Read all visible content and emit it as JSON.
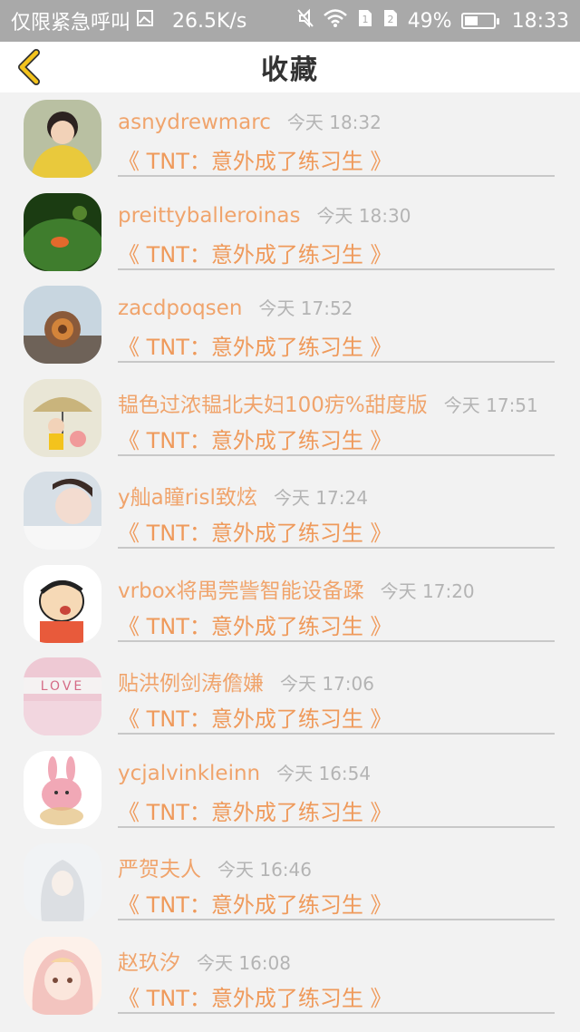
{
  "status_bar": {
    "carrier": "仅限紧急呼叫",
    "speed": "26.5K/s",
    "battery_percent": "49%",
    "battery_level": 0.49,
    "time": "18:33"
  },
  "header": {
    "title": "收藏",
    "back_icon": "chevron-left-icon",
    "accent": "#f3c31c"
  },
  "items": [
    {
      "user": "asnydrewmarc",
      "time": "今天 18:32",
      "book": "《 TNT：意外成了练习生 》",
      "avatar_color": "#e9c93c"
    },
    {
      "user": "preittyballeroinas",
      "time": "今天 18:30",
      "book": "《 TNT：意外成了练习生 》",
      "avatar_color": "#3f7d2d"
    },
    {
      "user": "zacdpoqsen",
      "time": "今天 17:52",
      "book": "《 TNT：意外成了练习生 》",
      "avatar_color": "#8a5a3a"
    },
    {
      "user": "韫色过浓韫北夫妇100疠%甜度版",
      "time": "今天 17:51",
      "book": "《 TNT：意外成了练习生 》",
      "avatar_color": "#c9b47c"
    },
    {
      "user": "y舢a瞳risl致炫",
      "time": "今天 17:24",
      "book": "《 TNT：意外成了练习生 》",
      "avatar_color": "#d7dfe6"
    },
    {
      "user": "vrbox将禺莞訾智能设备蹂",
      "time": "今天 17:20",
      "book": "《 TNT：意外成了练习生 》",
      "avatar_color": "#e85a3b"
    },
    {
      "user": "贴洪例剑涛儋嫌",
      "time": "今天 17:06",
      "book": "《 TNT：意外成了练习生 》",
      "avatar_color": "#eec9d4"
    },
    {
      "user": "ycjalvinkleinn",
      "time": "今天 16:54",
      "book": "《 TNT：意外成了练习生 》",
      "avatar_color": "#f1a8b6"
    },
    {
      "user": "严贺夫人",
      "time": "今天 16:46",
      "book": "《 TNT：意外成了练习生 》",
      "avatar_color": "#dcdfe3"
    },
    {
      "user": "赵玖汐",
      "time": "今天 16:08",
      "book": "《 TNT：意外成了练习生 》",
      "avatar_color": "#f3c4bf"
    }
  ]
}
